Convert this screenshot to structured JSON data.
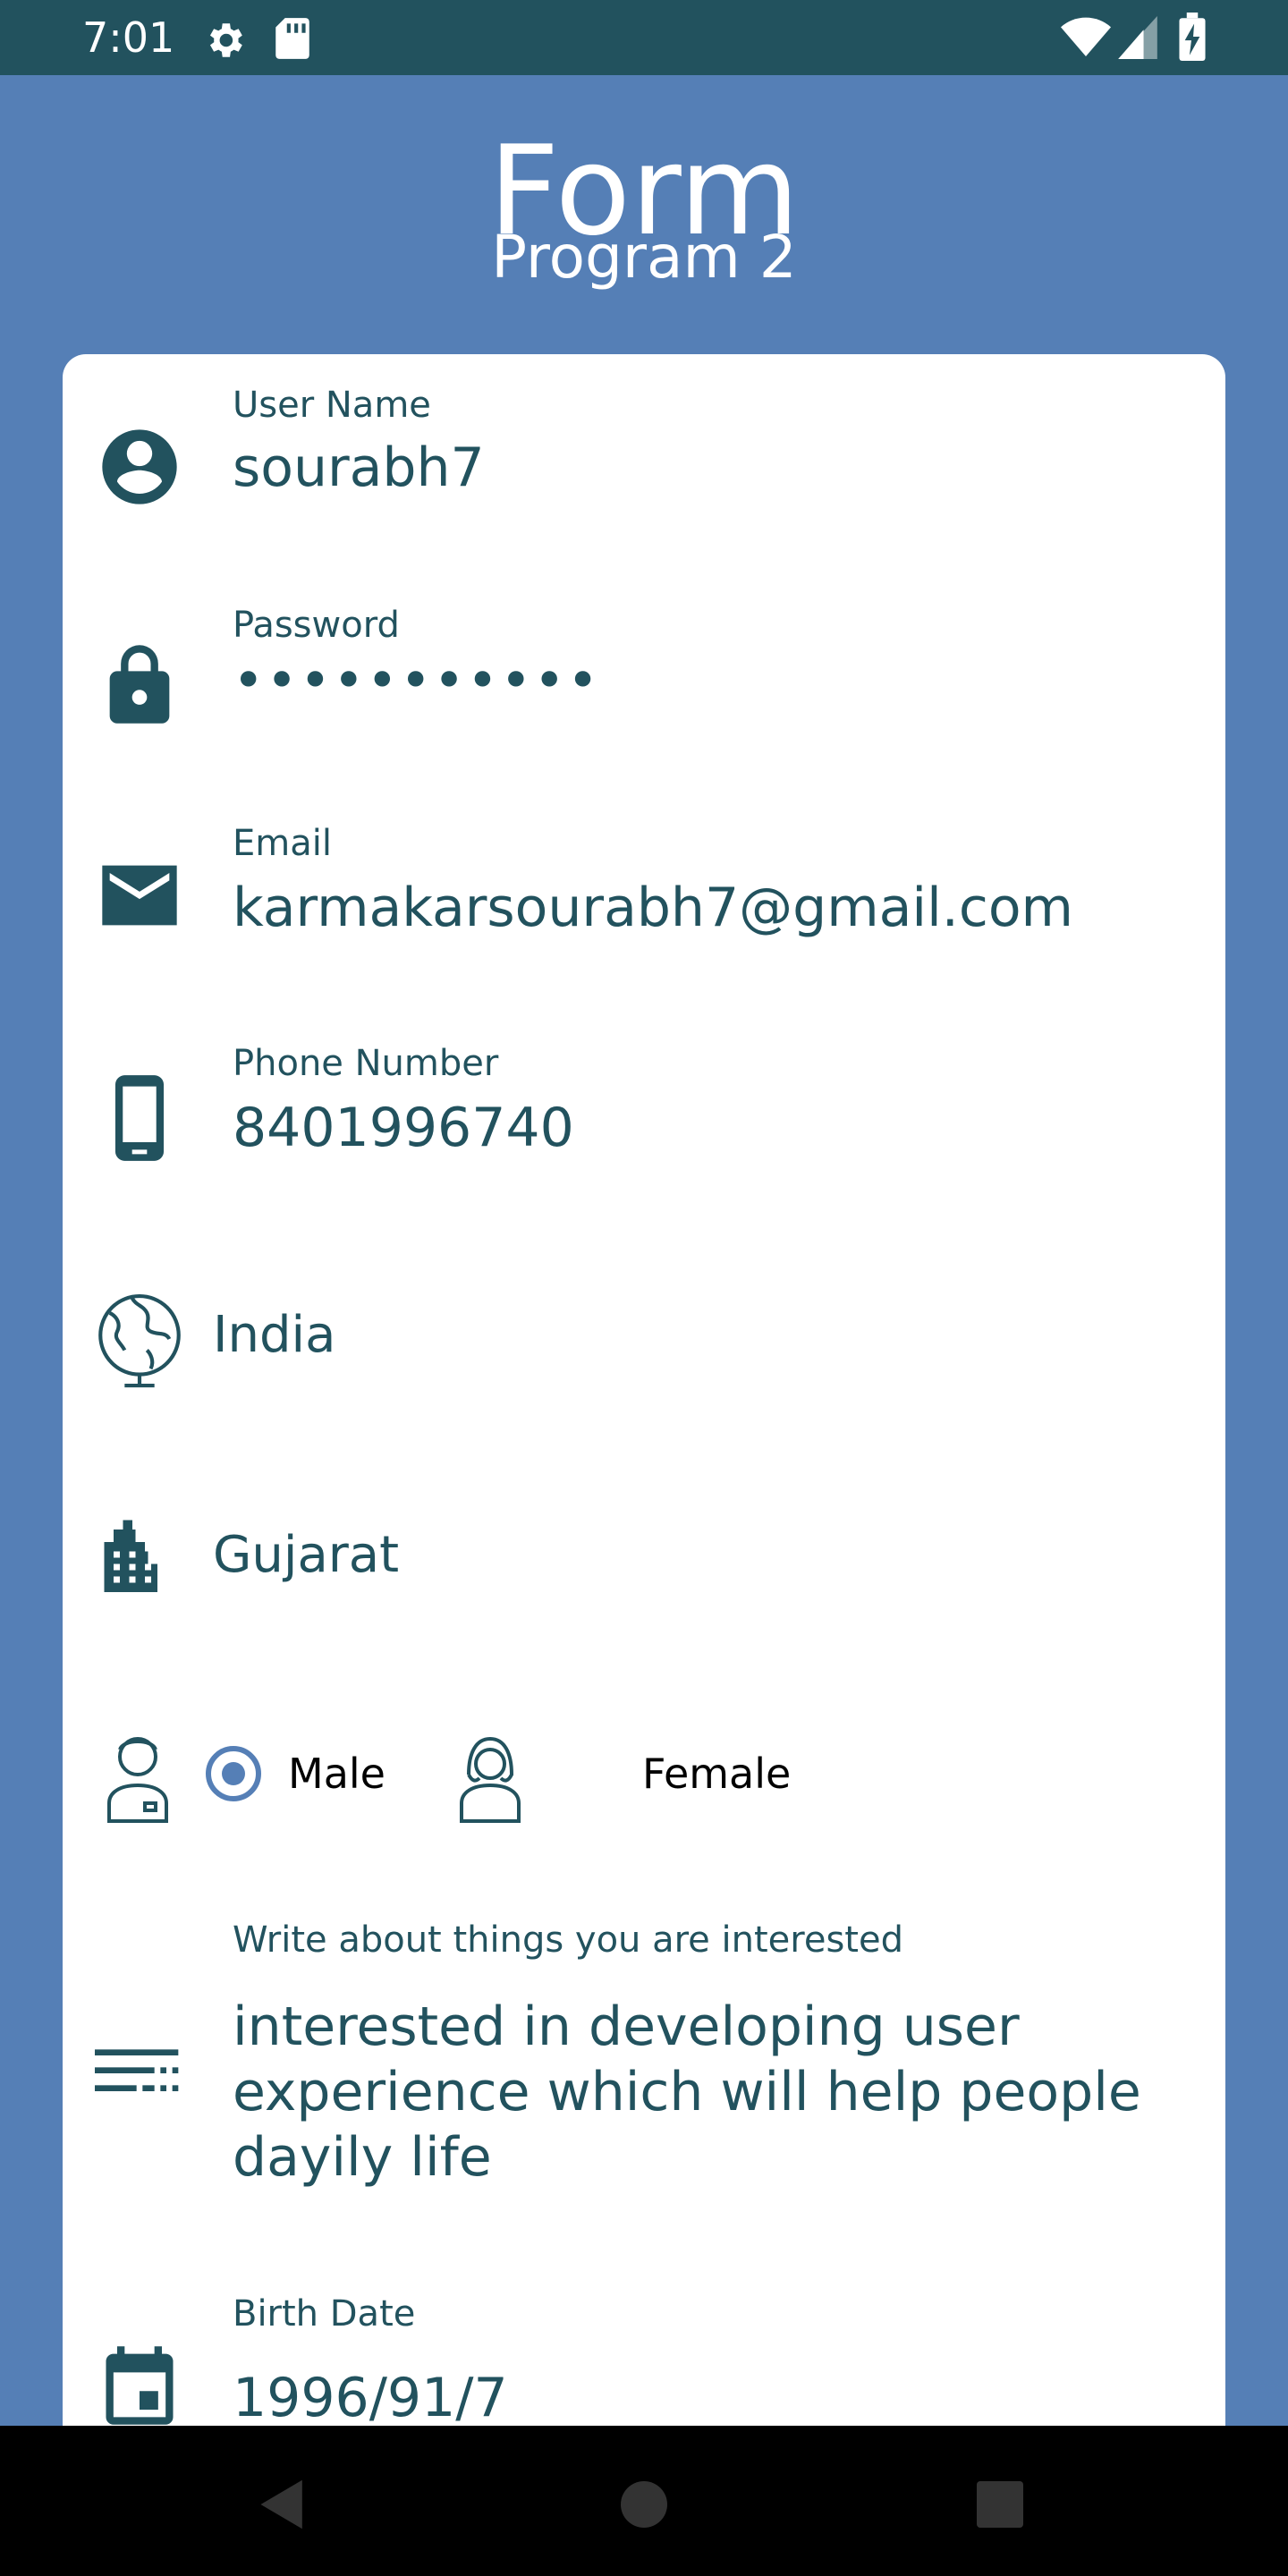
{
  "status_bar": {
    "time": "7:01",
    "icons_left": [
      "gear-icon",
      "sd-card-icon"
    ],
    "icons_right": [
      "wifi-icon",
      "cell-signal-icon",
      "battery-charging-icon"
    ]
  },
  "header": {
    "title": "Form",
    "subtitle": "Program 2"
  },
  "form": {
    "username": {
      "label": "User Name",
      "value": "sourabh7",
      "icon": "account-circle-icon"
    },
    "password": {
      "label": "Password",
      "value": "•••••••••••",
      "icon": "lock-icon"
    },
    "email": {
      "label": "Email",
      "value": "karmakarsourabh7@gmail.com",
      "icon": "mail-icon"
    },
    "phone": {
      "label": "Phone Number",
      "value": "8401996740",
      "icon": "phone-icon"
    },
    "country": {
      "value": "India",
      "icon": "globe-icon"
    },
    "state": {
      "value": "Gujarat",
      "icon": "city-icon"
    },
    "gender": {
      "options": [
        {
          "label": "Male",
          "selected": true,
          "icon": "male-avatar-icon"
        },
        {
          "label": "Female",
          "selected": false,
          "icon": "female-avatar-icon"
        }
      ]
    },
    "interests": {
      "label": "Write about things you are interested",
      "lines": [
        "interested in developing user",
        "experience which will help people",
        "dayily life"
      ],
      "icon": "notes-icon"
    },
    "birth_date": {
      "label": "Birth Date",
      "value": "1996/91/7",
      "icon": "calendar-icon"
    }
  },
  "colors": {
    "primary_dark": "#22525e",
    "accent": "#557fb6",
    "card": "#ffffff"
  },
  "nav_bar": {
    "buttons": [
      "back-icon",
      "home-icon",
      "recents-icon"
    ]
  }
}
